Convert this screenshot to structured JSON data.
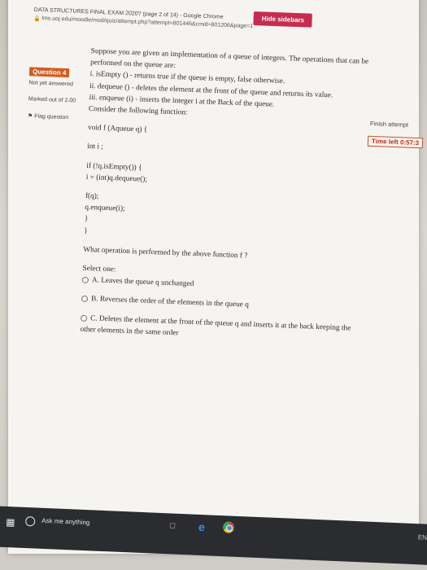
{
  "browser": {
    "window_title": "DATA STRUCTURES FINAL EXAM 2020? (page 2 of 14) - Google Chrome",
    "url": "lms.uoj.edu/moodle/mod/quiz/attempt.php?attempt=801446&cmid=801206&page=1"
  },
  "nav": {
    "question_label": "Question 4",
    "status": "Not yet answered",
    "marks": "Marked out of 2.00",
    "flag": "Flag question"
  },
  "sidebar": {
    "hide_label": "Hide sidebars",
    "finish_label": "Finish attempt",
    "timer": "Time left 0:57:3"
  },
  "question": {
    "lines": [
      "Suppose you are given an implementation of a queue of integers. The operations that can be",
      "performed on the queue are:",
      "i. isEmpty () - returns true if the queue is empty, false otherwise.",
      "ii. dequeue () - deletes the element at the front of the queue and returns its value.",
      "iii. enqueue (i) - inserts the integer i at the Back of the queue.",
      "Consider the following function:"
    ],
    "code": [
      "void f (Aqueue q) {",
      "int i ;",
      "if (!q.isEmpty()) {",
      "i = (int)q.dequeue();",
      "f(q);",
      "q.enqueue(i);",
      "}",
      "}"
    ],
    "prompt": "What operation is performed by the above function f ?",
    "select_label": "Select one:",
    "options": [
      "A. Leaves the queue q unchanged",
      "B. Reverses the order of the elements in the queue q",
      "C. Deletes the element at the front of the queue q and inserts it at the back keeping the",
      "other elements in the same order"
    ]
  },
  "taskbar": {
    "search_placeholder": "Ask me anything",
    "tray": "ENG"
  }
}
